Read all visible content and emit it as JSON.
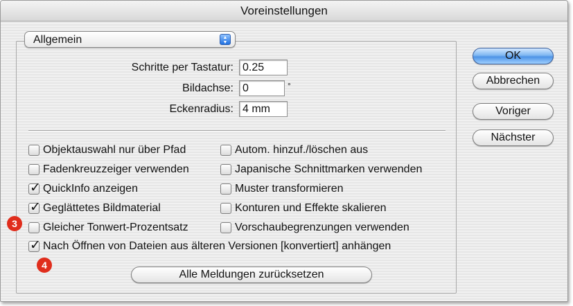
{
  "window": {
    "title": "Voreinstellungen"
  },
  "category_popup": {
    "selected": "Allgemein"
  },
  "fields": [
    {
      "label": "Schritte per Tastatur:",
      "value": "0.25",
      "unit": ""
    },
    {
      "label": "Bildachse:",
      "value": "0",
      "unit": "°"
    },
    {
      "label": "Eckenradius:",
      "value": "4 mm",
      "unit": ""
    }
  ],
  "checkboxes_left": [
    {
      "label": "Objektauswahl nur über Pfad",
      "checked": false
    },
    {
      "label": "Fadenkreuzzeiger verwenden",
      "checked": false
    },
    {
      "label": "QuickInfo anzeigen",
      "checked": true
    },
    {
      "label": "Geglättetes Bildmaterial",
      "checked": true
    },
    {
      "label": "Gleicher Tonwert-Prozentsatz",
      "checked": false
    }
  ],
  "checkboxes_right": [
    {
      "label": "Autom. hinzuf./löschen aus",
      "checked": false
    },
    {
      "label": "Japanische Schnittmarken verwenden",
      "checked": false
    },
    {
      "label": "Muster transformieren",
      "checked": false
    },
    {
      "label": "Konturen und Effekte skalieren",
      "checked": false
    },
    {
      "label": "Vorschaubegrenzungen verwenden",
      "checked": false
    }
  ],
  "checkbox_wide": {
    "label": "Nach Öffnen von Dateien aus älteren Versionen [konvertiert] anhängen",
    "checked": true
  },
  "reset_button": {
    "label": "Alle Meldungen zurücksetzen"
  },
  "buttons": {
    "ok": "OK",
    "cancel": "Abbrechen",
    "previous": "Voriger",
    "next": "Nächster"
  },
  "badges": [
    "3",
    "4"
  ],
  "colors": {
    "badge": "#e02d1c",
    "default_button": "#4d93e6",
    "popup_arrows": "#1f6fe0"
  }
}
